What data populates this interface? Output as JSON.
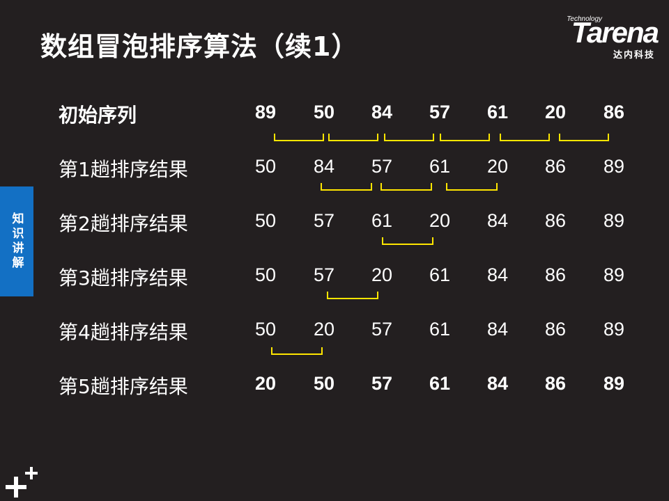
{
  "slide": {
    "title": "数组冒泡排序算法（续1）",
    "side_tab": "知识讲解"
  },
  "logo": {
    "tagline": "Technology",
    "wordmark": "Tarena",
    "chinese": "达内科技"
  },
  "rows": [
    {
      "label": "初始序列",
      "values": [
        "89",
        "50",
        "84",
        "57",
        "61",
        "20",
        "86"
      ]
    },
    {
      "label": "第1趟排序结果",
      "values": [
        "50",
        "84",
        "57",
        "61",
        "20",
        "86",
        "89"
      ]
    },
    {
      "label": "第2趟排序结果",
      "values": [
        "50",
        "57",
        "61",
        "20",
        "84",
        "86",
        "89"
      ]
    },
    {
      "label": "第3趟排序结果",
      "values": [
        "50",
        "57",
        "20",
        "61",
        "84",
        "86",
        "89"
      ]
    },
    {
      "label": "第4趟排序结果",
      "values": [
        "50",
        "20",
        "57",
        "61",
        "84",
        "86",
        "89"
      ]
    },
    {
      "label": "第5趟排序结果",
      "values": [
        "20",
        "50",
        "57",
        "61",
        "84",
        "86",
        "89"
      ]
    }
  ],
  "colors": {
    "background": "#231f20",
    "bracket": "#ffe600",
    "side_tab": "#1370c4",
    "text": "#ffffff"
  },
  "icons": [
    "plus-plus-icon"
  ]
}
